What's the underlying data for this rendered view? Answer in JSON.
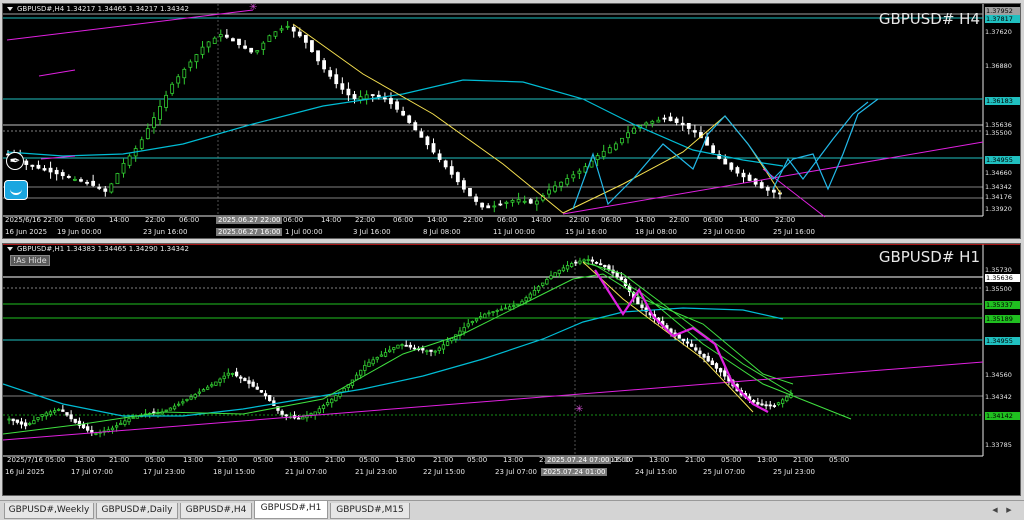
{
  "colors": {
    "bull": "#32cd32",
    "bear": "#ffffff",
    "cyan_ma": "#00bcd4",
    "pink": "#e020e0",
    "yellow": "#f5e050",
    "level": "#20c0c0",
    "green_level": "#20c020",
    "bid": "#a0a0a0"
  },
  "h4": {
    "header": "GBPUSD#,H4  1.34217 1.34465 1.34217 1.34342",
    "title": "GBPUSD#  H4",
    "price_labels": [
      {
        "text": "1.37952",
        "type": "tag",
        "bg": "#a0a0a0"
      },
      {
        "text": "1.37817",
        "type": "tag",
        "bg": "#20c0c0"
      },
      {
        "text": "1.37620",
        "type": "plain"
      },
      {
        "text": "1.36880",
        "type": "plain"
      },
      {
        "text": "1.36183",
        "type": "tag",
        "bg": "#20c0c0"
      },
      {
        "text": "1.35636",
        "type": "plain"
      },
      {
        "text": "1.35500",
        "type": "plain"
      },
      {
        "text": "1.34955",
        "type": "tag",
        "bg": "#20c0c0"
      },
      {
        "text": "1.34660",
        "type": "plain"
      },
      {
        "text": "1.34342",
        "type": "plain"
      },
      {
        "text": "1.34176",
        "type": "plain"
      },
      {
        "text": "1.33920",
        "type": "plain"
      }
    ],
    "time_labels": [
      "2025/6/16 22:00",
      "06:00",
      "14:00",
      "22:00",
      "06:00",
      "2025.06.27 22:00",
      "06:00",
      "14:00",
      "22:00",
      "06:00",
      "14:00",
      "22:00",
      "06:00",
      "14:00",
      "22:00",
      "06:00",
      "14:00",
      "22:00",
      "06:00",
      "14:00",
      "22:00"
    ],
    "time_labels2": [
      "16 Jun 2025",
      "19 Jun 00:00",
      "23 Jun 16:00",
      "2025.06.27 16:00",
      "1 Jul 00:00",
      "3 Jul 16:00",
      "8 Jul 08:00",
      "11 Jul 00:00",
      "15 Jul 16:00",
      "18 Jul 08:00",
      "23 Jul 00:00",
      "25 Jul 16:00"
    ]
  },
  "h1": {
    "header": "GBPUSD#,H1  1.34383 1.34465 1.34290 1.34342",
    "title": "GBPUSD#  H1",
    "indicator_label": "!As Hide",
    "price_labels": [
      {
        "text": "1.35730",
        "type": "plain"
      },
      {
        "text": "1.35636",
        "type": "tag",
        "bg": "#ffffff"
      },
      {
        "text": "1.35500",
        "type": "plain"
      },
      {
        "text": "1.35337",
        "type": "tag",
        "bg": "#20c020"
      },
      {
        "text": "1.35189",
        "type": "tag",
        "bg": "#20c020"
      },
      {
        "text": "1.34955",
        "type": "tag",
        "bg": "#20c0c0"
      },
      {
        "text": "1.34560",
        "type": "plain"
      },
      {
        "text": "1.34342",
        "type": "plain"
      },
      {
        "text": "1.34142",
        "type": "tag",
        "bg": "#20c020"
      },
      {
        "text": "1.33785",
        "type": "plain"
      }
    ],
    "time_labels": [
      "2025/7/16 05:00",
      "13:00",
      "21:00",
      "05:00",
      "13:00",
      "21:00",
      "05:00",
      "13:00",
      "21:00",
      "05:00",
      "13:00",
      "21:00",
      "05:00",
      "13:00",
      "21:00",
      "05:00",
      "13:00",
      "2025.07.24 07:00",
      "05:00",
      "13:00",
      "21:00",
      "05:00",
      "13:00",
      "21:00",
      "05:00"
    ],
    "time_labels2": [
      "16 Jul 2025",
      "17 Jul 07:00",
      "17 Jul 23:00",
      "18 Jul 15:00",
      "21 Jul 07:00",
      "21 Jul 23:00",
      "22 Jul 15:00",
      "23 Jul 07:00",
      "2025.07.24 01:00",
      "24 Jul 15:00",
      "25 Jul 07:00",
      "25 Jul 23:00"
    ]
  },
  "tabs": [
    "GBPUSD#,Weekly",
    "GBPUSD#,Daily",
    "GBPUSD#,H4",
    "GBPUSD#,H1",
    "GBPUSD#,M15"
  ],
  "active_tab": "GBPUSD#,H1"
}
